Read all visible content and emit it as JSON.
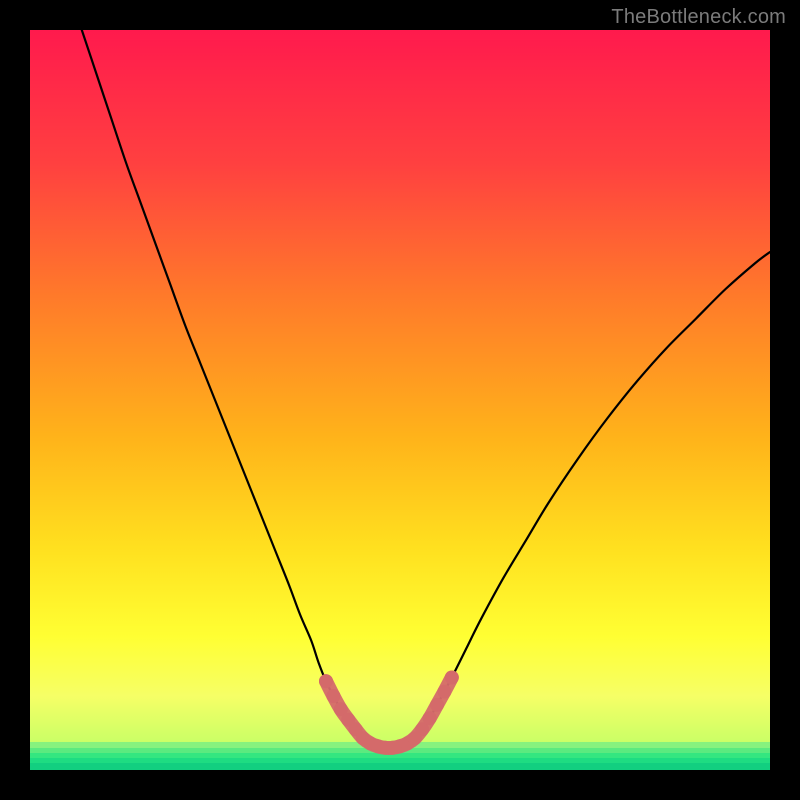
{
  "watermark": {
    "text": "TheBottleneck.com"
  },
  "colors": {
    "black": "#000000",
    "curve": "#000000",
    "marker": "#d46a6a",
    "grad_top": "#ff1a4d",
    "grad_mid1": "#ff7a2a",
    "grad_mid2": "#ffd21f",
    "grad_mid3": "#ffff33",
    "grad_mid4": "#f6ff66",
    "grad_low": "#ccff66",
    "green1": "#7ff07a",
    "green2": "#34e680",
    "green3": "#1edc82",
    "green4": "#17d181",
    "green5": "#0fc77e"
  },
  "chart_data": {
    "type": "line",
    "title": "",
    "xlabel": "",
    "ylabel": "",
    "xlim": [
      0,
      100
    ],
    "ylim": [
      0,
      100
    ],
    "grid": false,
    "legend": false,
    "series": [
      {
        "name": "left-curve",
        "x": [
          7,
          9,
          11,
          13,
          15,
          17,
          19,
          21,
          23,
          25,
          27,
          29,
          31,
          33,
          35,
          36.5,
          38,
          39,
          40,
          41,
          42,
          43,
          44,
          45
        ],
        "y": [
          100,
          94,
          88,
          82,
          76.5,
          71,
          65.5,
          60,
          55,
          50,
          45,
          40,
          35,
          30,
          25,
          21,
          17.5,
          14.5,
          12,
          10,
          8.2,
          6.8,
          5.5,
          4.3
        ]
      },
      {
        "name": "valley-floor",
        "x": [
          45,
          46,
          47,
          48,
          49,
          50,
          51,
          52
        ],
        "y": [
          4.3,
          3.6,
          3.2,
          3.0,
          3.0,
          3.2,
          3.6,
          4.3
        ]
      },
      {
        "name": "right-curve",
        "x": [
          52,
          53,
          54,
          55,
          57,
          59,
          61,
          64,
          67,
          70,
          74,
          78,
          82,
          86,
          90,
          94,
          98,
          100
        ],
        "y": [
          4.3,
          5.5,
          7.0,
          8.8,
          12.5,
          16.5,
          20.5,
          26,
          31,
          36,
          42,
          47.5,
          52.5,
          57,
          61,
          65,
          68.5,
          70
        ]
      },
      {
        "name": "highlighted-valley-markers",
        "x": [
          40,
          41,
          42,
          43,
          44,
          45,
          46,
          47,
          48,
          49,
          50,
          51,
          52,
          53,
          54,
          55,
          56,
          57
        ],
        "y": [
          12,
          10,
          8.2,
          6.8,
          5.5,
          4.3,
          3.6,
          3.2,
          3.0,
          3.0,
          3.2,
          3.6,
          4.3,
          5.5,
          7.0,
          8.8,
          10.6,
          12.5
        ]
      }
    ],
    "annotations": [
      {
        "text": "TheBottleneck.com",
        "pos": "top-right"
      }
    ],
    "note": "Axes are unlabeled in the source image; x and y are normalized 0–100. Values estimated from pixel positions."
  }
}
